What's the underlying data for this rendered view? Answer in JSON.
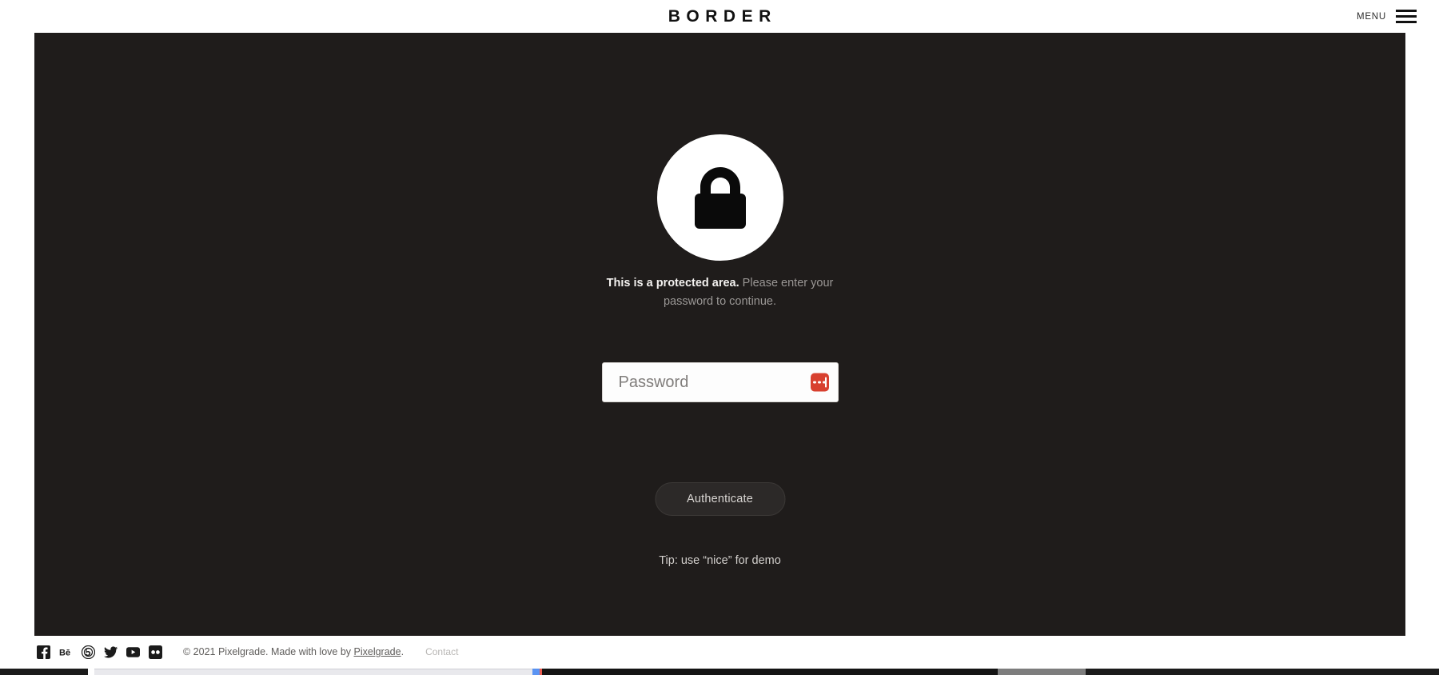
{
  "header": {
    "brand": "BORDER",
    "menu_label": "MENU",
    "menu_icon": "hamburger-icon"
  },
  "protected": {
    "lock_icon": "lock-icon",
    "headline": "This is a protected area.",
    "subtext": " Please enter your password to continue.",
    "password_placeholder": "Password",
    "password_value": "",
    "password_manager_icon": "password-manager-icon",
    "submit_label": "Authenticate",
    "tip": "Tip: use “nice” for demo"
  },
  "footer": {
    "socials": [
      {
        "name": "facebook-icon",
        "label": "Facebook"
      },
      {
        "name": "behance-icon",
        "label": "Behance"
      },
      {
        "name": "fivehundredpx-icon",
        "label": "500px"
      },
      {
        "name": "twitter-icon",
        "label": "Twitter"
      },
      {
        "name": "youtube-icon",
        "label": "YouTube"
      },
      {
        "name": "flickr-icon",
        "label": "Flickr"
      }
    ],
    "copyright_prefix": "© 2021 Pixelgrade. Made with love by ",
    "copyright_link": "Pixelgrade",
    "copyright_suffix": ".",
    "contact_label": "Contact"
  },
  "colors": {
    "panel_background": "#1f1c1b",
    "page_background": "#ffffff",
    "accent_red": "#d8402f",
    "text_muted": "#9a9795"
  }
}
